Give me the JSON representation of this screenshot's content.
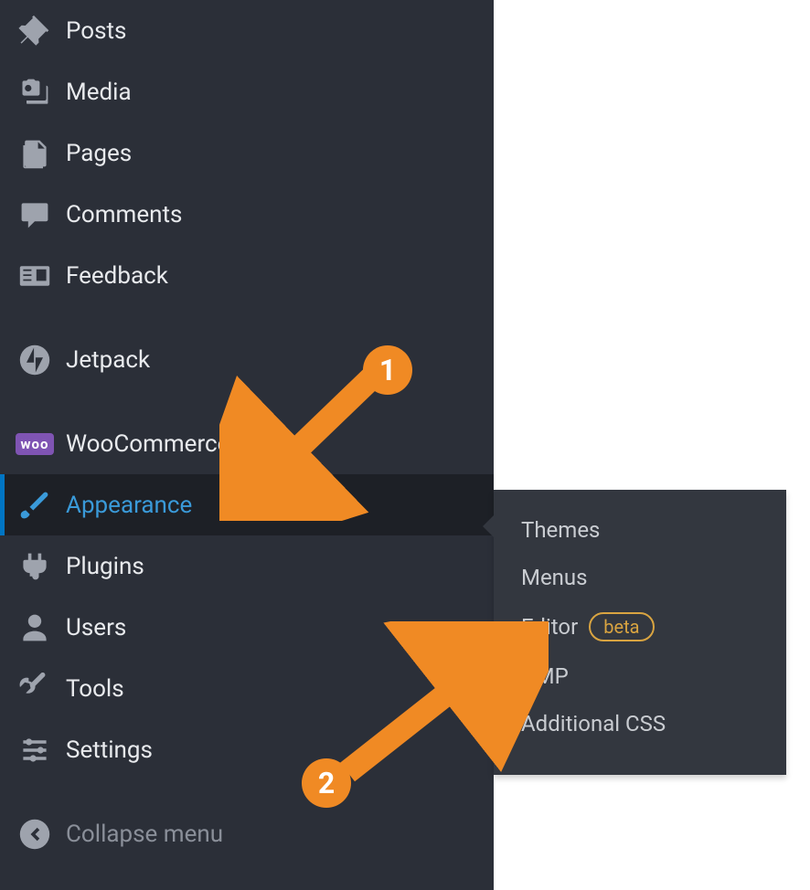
{
  "sidebar": {
    "items": [
      {
        "key": "posts",
        "label": "Posts"
      },
      {
        "key": "media",
        "label": "Media"
      },
      {
        "key": "pages",
        "label": "Pages"
      },
      {
        "key": "comments",
        "label": "Comments"
      },
      {
        "key": "feedback",
        "label": "Feedback"
      },
      {
        "key": "jetpack",
        "label": "Jetpack"
      },
      {
        "key": "woocommerce",
        "label": "WooCommerce",
        "icon_text": "woo"
      },
      {
        "key": "appearance",
        "label": "Appearance",
        "active": true
      },
      {
        "key": "plugins",
        "label": "Plugins"
      },
      {
        "key": "users",
        "label": "Users"
      },
      {
        "key": "tools",
        "label": "Tools"
      },
      {
        "key": "settings",
        "label": "Settings"
      }
    ],
    "collapse_label": "Collapse menu"
  },
  "flyout": {
    "items": [
      {
        "label": "Themes"
      },
      {
        "label": "Menus"
      },
      {
        "label": "Editor",
        "badge": "beta"
      },
      {
        "label": "AMP"
      },
      {
        "label": "Additional CSS"
      }
    ]
  },
  "annotations": {
    "step1": "1",
    "step2": "2"
  },
  "colors": {
    "accent": "#3a9ad9",
    "annotation": "#f08a24",
    "beta": "#d9a441"
  }
}
